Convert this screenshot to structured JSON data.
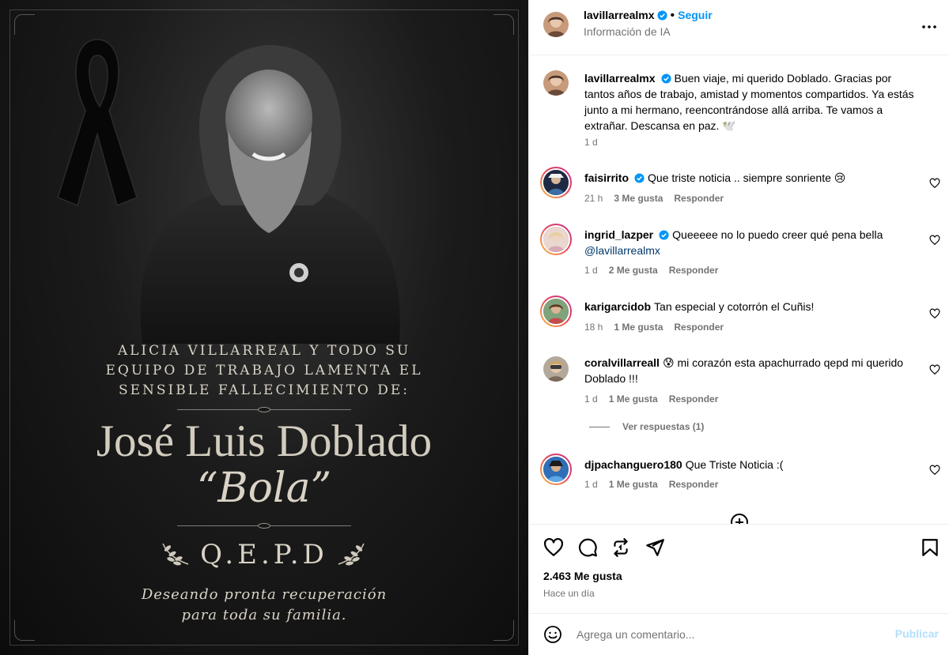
{
  "post": {
    "ribbon_icon": "mourning-ribbon",
    "caption_lines": [
      "ALICIA VILLARREAL Y TODO SU",
      "EQUIPO DE TRABAJO LAMENTA EL",
      "SENSIBLE FALLECIMIENTO DE:"
    ],
    "name": "José Luis Doblado",
    "nickname": "“Bola”",
    "qepd": "Q.E.P.D",
    "wish_lines": [
      "Deseando pronta recuperación",
      "para toda su familia."
    ]
  },
  "header": {
    "username": "lavillarrealmx",
    "separator": "•",
    "follow_label": "Seguir",
    "subtitle": "Información de IA"
  },
  "caption": {
    "username": "lavillarrealmx",
    "text": "Buen viaje, mi querido Doblado. Gracias por tantos años de trabajo, amistad y momentos compartidos. Ya estás junto a mi hermano, reencontrándose allá arriba. Te vamos a extrañar. Descansa en paz. 🕊️",
    "time": "1 d"
  },
  "comments": [
    {
      "username": "faisirrito",
      "verified": true,
      "text": "Que triste noticia .. siempre sonriente 😢",
      "time": "21 h",
      "likes": "3 Me gusta",
      "reply": "Responder"
    },
    {
      "username": "ingrid_lazper",
      "verified": true,
      "text": "Queeeee no lo puedo creer qué pena bella",
      "mention": "@lavillarrealmx",
      "time": "1 d",
      "likes": "2 Me gusta",
      "reply": "Responder"
    },
    {
      "username": "karigarcidob",
      "verified": false,
      "text": "Tan especial y cotorrón el Cuñis!",
      "time": "18 h",
      "likes": "1 Me gusta",
      "reply": "Responder"
    },
    {
      "username": "coralvillarreall",
      "verified": false,
      "text": "😰 mi corazón esta apachurrado qepd mi querido Doblado !!!",
      "time": "1 d",
      "likes": "1 Me gusta",
      "reply": "Responder"
    },
    {
      "username": "djpachanguero180",
      "verified": false,
      "text": "Que Triste Noticia :(",
      "time": "1 d",
      "likes": "1 Me gusta",
      "reply": "Responder"
    }
  ],
  "view_replies": "Ver respuestas (1)",
  "actions": {
    "likes": "2.463 Me gusta",
    "time": "Hace un día"
  },
  "composer": {
    "placeholder": "Agrega un comentario...",
    "post_label": "Publicar"
  },
  "colors": {
    "accent": "#0095f6",
    "muted": "#737373",
    "post_disabled": "#b2dffc"
  }
}
